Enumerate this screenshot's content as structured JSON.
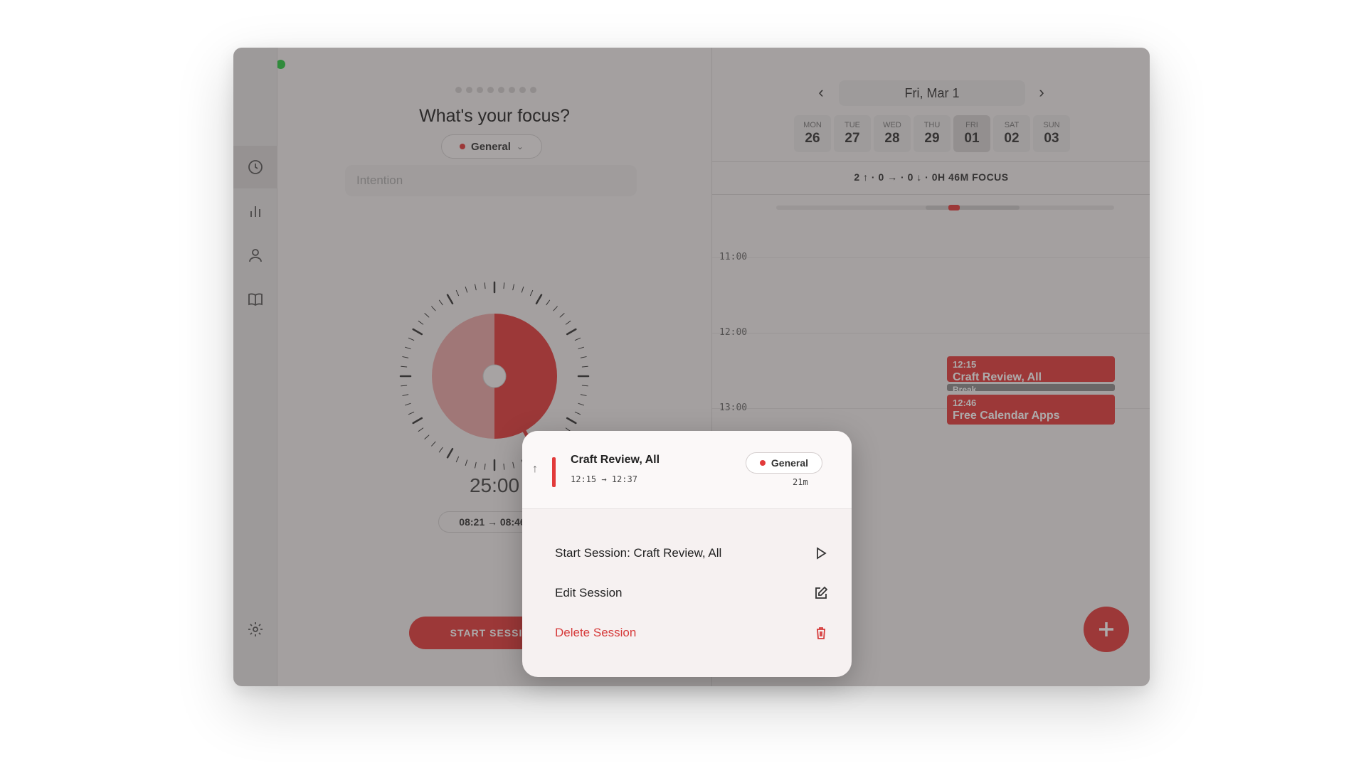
{
  "sidebar": {
    "items": [
      {
        "name": "clock-icon",
        "active": true
      },
      {
        "name": "bar-chart-icon",
        "active": false
      },
      {
        "name": "person-icon",
        "active": false
      },
      {
        "name": "book-icon",
        "active": false
      },
      {
        "name": "gear-icon",
        "active": false
      }
    ]
  },
  "focus": {
    "title": "What's your focus?",
    "category": "General",
    "intention_placeholder": "Intention",
    "timer": "25:00",
    "time_range": "08:21 → 08:46",
    "start_button": "START SESSION"
  },
  "calendar": {
    "date_label": "Fri, Mar 1",
    "week": [
      {
        "day": "MON",
        "date": "26"
      },
      {
        "day": "TUE",
        "date": "27"
      },
      {
        "day": "WED",
        "date": "28"
      },
      {
        "day": "THU",
        "date": "29"
      },
      {
        "day": "FRI",
        "date": "01",
        "selected": true
      },
      {
        "day": "SAT",
        "date": "02"
      },
      {
        "day": "SUN",
        "date": "03"
      }
    ],
    "stats": "2 ↑ · 0 → · 0 ↓ · 0H 46M FOCUS",
    "hours": [
      "11:00",
      "12:00",
      "13:00"
    ],
    "events": [
      {
        "time": "12:15",
        "name": "Craft Review, All"
      },
      {
        "time": "",
        "name": "Break"
      },
      {
        "time": "12:46",
        "name": "Free Calendar Apps"
      }
    ]
  },
  "popup": {
    "title": "Craft Review, All",
    "time_range": "12:15 → 12:37",
    "category": "General",
    "duration": "21m",
    "actions": [
      {
        "label": "Start Session: Craft Review, All",
        "icon": "play-icon"
      },
      {
        "label": "Edit Session",
        "icon": "edit-icon"
      },
      {
        "label": "Delete Session",
        "icon": "trash-icon"
      }
    ]
  },
  "colors": {
    "accent": "#e23a3a",
    "overlay": "#3c3737"
  }
}
